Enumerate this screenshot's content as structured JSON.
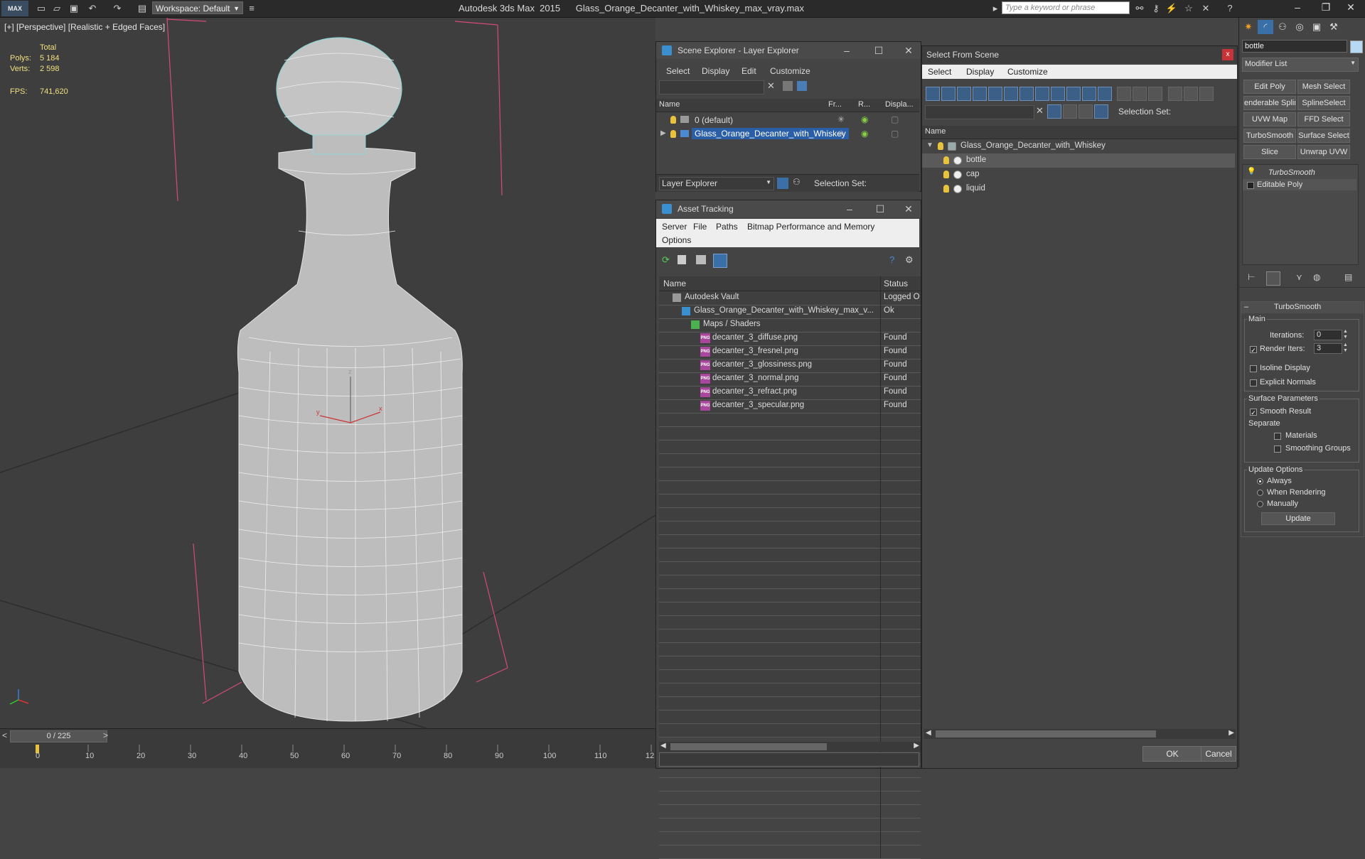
{
  "titlebar": {
    "app_logo": "MAX",
    "workspace": "Workspace: Default",
    "title": "Autodesk 3ds Max  2015      Glass_Orange_Decanter_with_Whiskey_max_vray.max",
    "search_placeholder": "Type a keyword or phrase",
    "window_controls": [
      "–",
      "❐",
      "✕"
    ]
  },
  "viewport": {
    "label": "[+] [Perspective] [Realistic + Edged Faces]",
    "stats": {
      "total_label": "Total",
      "polys_label": "Polys:",
      "polys_value": "5 184",
      "verts_label": "Verts:",
      "verts_value": "2 598",
      "fps_label": "FPS:",
      "fps_value": "741,620"
    },
    "axis_labels": {
      "x": "x",
      "y": "y",
      "z": "z"
    }
  },
  "timeline": {
    "slider_label": "0 / 225",
    "prev": "<",
    "next": ">",
    "ticks": [
      "0",
      "10",
      "20",
      "30",
      "40",
      "50",
      "60",
      "70",
      "80",
      "90",
      "100",
      "110",
      "12"
    ]
  },
  "scene_explorer": {
    "title": "Scene Explorer - Layer Explorer",
    "menu": [
      "Select",
      "Display",
      "Edit",
      "Customize"
    ],
    "columns": [
      "Name",
      "Fr...",
      "R...",
      "Displa..."
    ],
    "rows": [
      {
        "name": "0 (default)",
        "selected": false
      },
      {
        "name": "Glass_Orange_Decanter_with_Whiskey",
        "selected": true
      }
    ],
    "footer_dropdown": "Layer Explorer",
    "selection_set_label": "Selection Set:"
  },
  "asset_tracking": {
    "title": "Asset Tracking",
    "menu": [
      "Server",
      "File",
      "Paths",
      "Bitmap Performance and Memory",
      "Options"
    ],
    "columns": {
      "name": "Name",
      "status": "Status"
    },
    "rows": [
      {
        "name": "Autodesk Vault",
        "status": "Logged O",
        "indent": 1,
        "icon": "vault-icon"
      },
      {
        "name": "Glass_Orange_Decanter_with_Whiskey_max_v...",
        "status": "Ok",
        "indent": 2,
        "icon": "max-file-icon"
      },
      {
        "name": "Maps / Shaders",
        "status": "",
        "indent": 3,
        "icon": "maps-icon"
      },
      {
        "name": "decanter_3_diffuse.png",
        "status": "Found",
        "indent": 4,
        "icon": "png-icon"
      },
      {
        "name": "decanter_3_fresnel.png",
        "status": "Found",
        "indent": 4,
        "icon": "png-icon"
      },
      {
        "name": "decanter_3_glossiness.png",
        "status": "Found",
        "indent": 4,
        "icon": "png-icon"
      },
      {
        "name": "decanter_3_normal.png",
        "status": "Found",
        "indent": 4,
        "icon": "png-icon"
      },
      {
        "name": "decanter_3_refract.png",
        "status": "Found",
        "indent": 4,
        "icon": "png-icon"
      },
      {
        "name": "decanter_3_specular.png",
        "status": "Found",
        "indent": 4,
        "icon": "png-icon"
      }
    ],
    "png_badge": "PNG"
  },
  "select_from_scene": {
    "title": "Select From Scene",
    "close": "x",
    "menu": [
      "Select",
      "Display",
      "Customize"
    ],
    "selection_set_label": "Selection Set:",
    "column_name": "Name",
    "tree": [
      {
        "name": "Glass_Orange_Decanter_with_Whiskey",
        "level": 0,
        "selected": false
      },
      {
        "name": "bottle",
        "level": 1,
        "selected": true
      },
      {
        "name": "cap",
        "level": 1,
        "selected": false
      },
      {
        "name": "liquid",
        "level": 1,
        "selected": false
      }
    ],
    "ok_label": "OK",
    "cancel_label": "Cancel"
  },
  "command_panel": {
    "object_name": "bottle",
    "color_swatch": "#b8d9f4",
    "modifier_list": "Modifier List",
    "modifier_buttons": [
      "Edit Poly",
      "Mesh Select",
      "enderable Splir",
      "SplineSelect",
      "UVW Map",
      "FFD Select",
      "TurboSmooth",
      "Surface Select",
      "Slice",
      "Unwrap UVW"
    ],
    "stack": [
      "TurboSmooth",
      "Editable Poly"
    ],
    "rollout_title": "TurboSmooth",
    "main_label": "Main",
    "iterations_label": "Iterations:",
    "iterations_value": "0",
    "render_iters_label": "Render Iters:",
    "render_iters_value": "3",
    "render_iters_checked": "✓",
    "isoline_label": "Isoline Display",
    "explicit_normals_label": "Explicit Normals",
    "surface_params_label": "Surface Parameters",
    "smooth_result_label": "Smooth Result",
    "smooth_result_checked": "✓",
    "separate_label": "Separate",
    "materials_label": "Materials",
    "smoothing_groups_label": "Smoothing Groups",
    "update_options_label": "Update Options",
    "always_label": "Always",
    "when_rendering_label": "When Rendering",
    "manually_label": "Manually",
    "update_button": "Update"
  }
}
